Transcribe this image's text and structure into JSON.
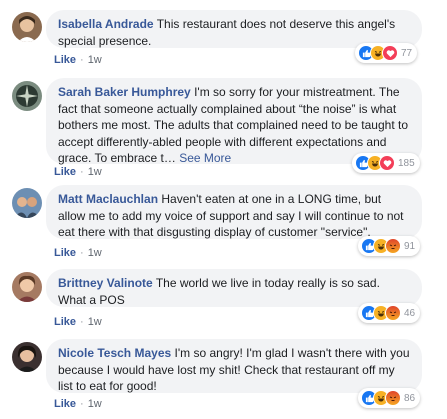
{
  "comments": [
    {
      "author": "Isabella Andrade",
      "text": "This restaurant does not deserve this angel's special presence.",
      "see_more": "",
      "like_label": "Like",
      "time": "1w",
      "reaction_count": "77",
      "reactions": [
        "like-icon",
        "haha-icon",
        "love-icon"
      ]
    },
    {
      "author": "Sarah Baker Humphrey",
      "text": "I'm so sorry for your mistreatment. The fact that someone actually complained about “the noise” is what bothers me most. The adults that complained need to be taught to accept differently-abled people with different expectations and grace. To embrace t…",
      "see_more": "See More",
      "like_label": "Like",
      "time": "1w",
      "reaction_count": "185",
      "reactions": [
        "like-icon",
        "haha-icon",
        "love-icon"
      ]
    },
    {
      "author": "Matt Maclauchlan",
      "text": "Haven't eaten at one in a LONG time, but allow me to add my voice of support and say I will continue to not eat there with that disgusting display of customer \"service\".",
      "see_more": "",
      "like_label": "Like",
      "time": "1w",
      "reaction_count": "91",
      "reactions": [
        "like-icon",
        "haha-icon",
        "angry-icon"
      ]
    },
    {
      "author": "Brittney Valinote",
      "text": "The world we live in today really is so sad. What a POS",
      "see_more": "",
      "like_label": "Like",
      "time": "1w",
      "reaction_count": "46",
      "reactions": [
        "like-icon",
        "haha-icon",
        "angry-icon"
      ]
    },
    {
      "author": "Nicole Tesch Mayes",
      "text": "I'm so angry! I'm glad I wasn't there with you because I would have lost my shit! Check that restaurant off my list to eat for good!",
      "see_more": "",
      "like_label": "Like",
      "time": "1w",
      "reaction_count": "86",
      "reactions": [
        "like-icon",
        "haha-icon",
        "angry-icon"
      ]
    }
  ],
  "colors": {
    "link": "#385898",
    "bubble": "#f2f3f5",
    "like": "#1877f2",
    "love": "#f33e58",
    "haha": "#f7b125",
    "angry": "#e9710f"
  }
}
